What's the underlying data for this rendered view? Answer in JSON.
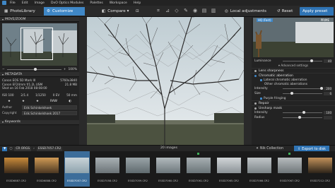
{
  "menu": {
    "items": [
      "File",
      "Edit",
      "Image",
      "DxO Optics Modules",
      "Palettes",
      "Workspace",
      "Help"
    ]
  },
  "toolbar": {
    "tab_library": "PhotoLibrary",
    "tab_customize": "Customize",
    "compare": "Compare",
    "local_adjustments": "Local adjustments",
    "reset": "Reset",
    "apply_preset": "Apply preset"
  },
  "left": {
    "move_zoom_header": "MOVE/ZOOM",
    "zoom_value": "100%",
    "metadata_header": "METADATA",
    "meta_rows": [
      {
        "k": "Canon EOS 5D Mark III",
        "v": "5760x3840"
      },
      {
        "k": "Canon EF24mm f/1.2L USM",
        "v": "21.8 MB"
      },
      {
        "k": "Shot on 16 Feb 2018 08:08:00",
        "v": ""
      }
    ],
    "exif_row1": [
      "ISO 100",
      "2/1.4",
      "1/1250",
      "0 EV",
      "50 mm"
    ],
    "exif_row2": [
      "★",
      "★",
      "★",
      "RAW",
      "◐"
    ],
    "author_label": "Author",
    "author_value": "Erik Schinkelshoek",
    "copyright_label": "Copyright",
    "copyright_value": "Erik Schinkelshoek 2017",
    "keywords_header": "Keywords"
  },
  "right": {
    "hq_label": "HQ (Fast)",
    "prime_label": "PRIME",
    "luminance_label": "Luminance",
    "luminance_value": "40",
    "advanced_settings": "Advanced settings",
    "lens_sharpness": "Lens sharpness",
    "chromatic_aberration": "Chromatic aberration",
    "lateral_ca": "Lateral chromatic aberration",
    "other_ca": "Other chromatic aberrations",
    "intensity_label": "Intensity",
    "intensity_value": "200",
    "size_label": "Size",
    "size_value": "6",
    "purple_fringing": "Purple fringing",
    "repair": "Repair",
    "unsharp_mask": "Unsharp mask",
    "um_intensity_label": "Intensity",
    "um_intensity_value": "100",
    "radius_label": "Radius"
  },
  "bottom": {
    "path": [
      "CR ORGS",
      "ESSD7057.CR2"
    ],
    "count": "20 images",
    "nik": "Nik Collection",
    "export": "Export to disk"
  },
  "filmstrip": [
    {
      "name": "ESSD6887.CR2",
      "colors": [
        "#3b2a1a",
        "#c98b3a"
      ],
      "mark": false
    },
    {
      "name": "ESSD6888.CR2",
      "colors": [
        "#4a3722",
        "#d19b55"
      ],
      "mark": false
    },
    {
      "name": "ESSD7057.CR2",
      "colors": [
        "#8ea3ad",
        "#c9d3d8"
      ],
      "mark": false,
      "selected": true
    },
    {
      "name": "ESSD7058.CR2",
      "colors": [
        "#6b7377",
        "#a9b1b4"
      ],
      "mark": false
    },
    {
      "name": "ESSD7059.CR2",
      "colors": [
        "#5f6a6e",
        "#9aa4a8"
      ],
      "mark": false
    },
    {
      "name": "ESSD7060.CR2",
      "colors": [
        "#6d777b",
        "#b2babd"
      ],
      "mark": false
    },
    {
      "name": "ESSD7061.CR2",
      "colors": [
        "#6a7478",
        "#a7afb2"
      ],
      "mark": true
    },
    {
      "name": "ESSD7065.CR2",
      "colors": [
        "#8b9296",
        "#d2d6d8"
      ],
      "mark": false
    },
    {
      "name": "ESSD7066.CR2",
      "colors": [
        "#7b8386",
        "#c1c6c8"
      ],
      "mark": false
    },
    {
      "name": "ESSD7067.CR2",
      "colors": [
        "#6f7679",
        "#b7bcbe"
      ],
      "mark": true
    },
    {
      "name": "ESSD7212.CR2",
      "colors": [
        "#2c2419",
        "#c2915a"
      ],
      "mark": false
    }
  ]
}
